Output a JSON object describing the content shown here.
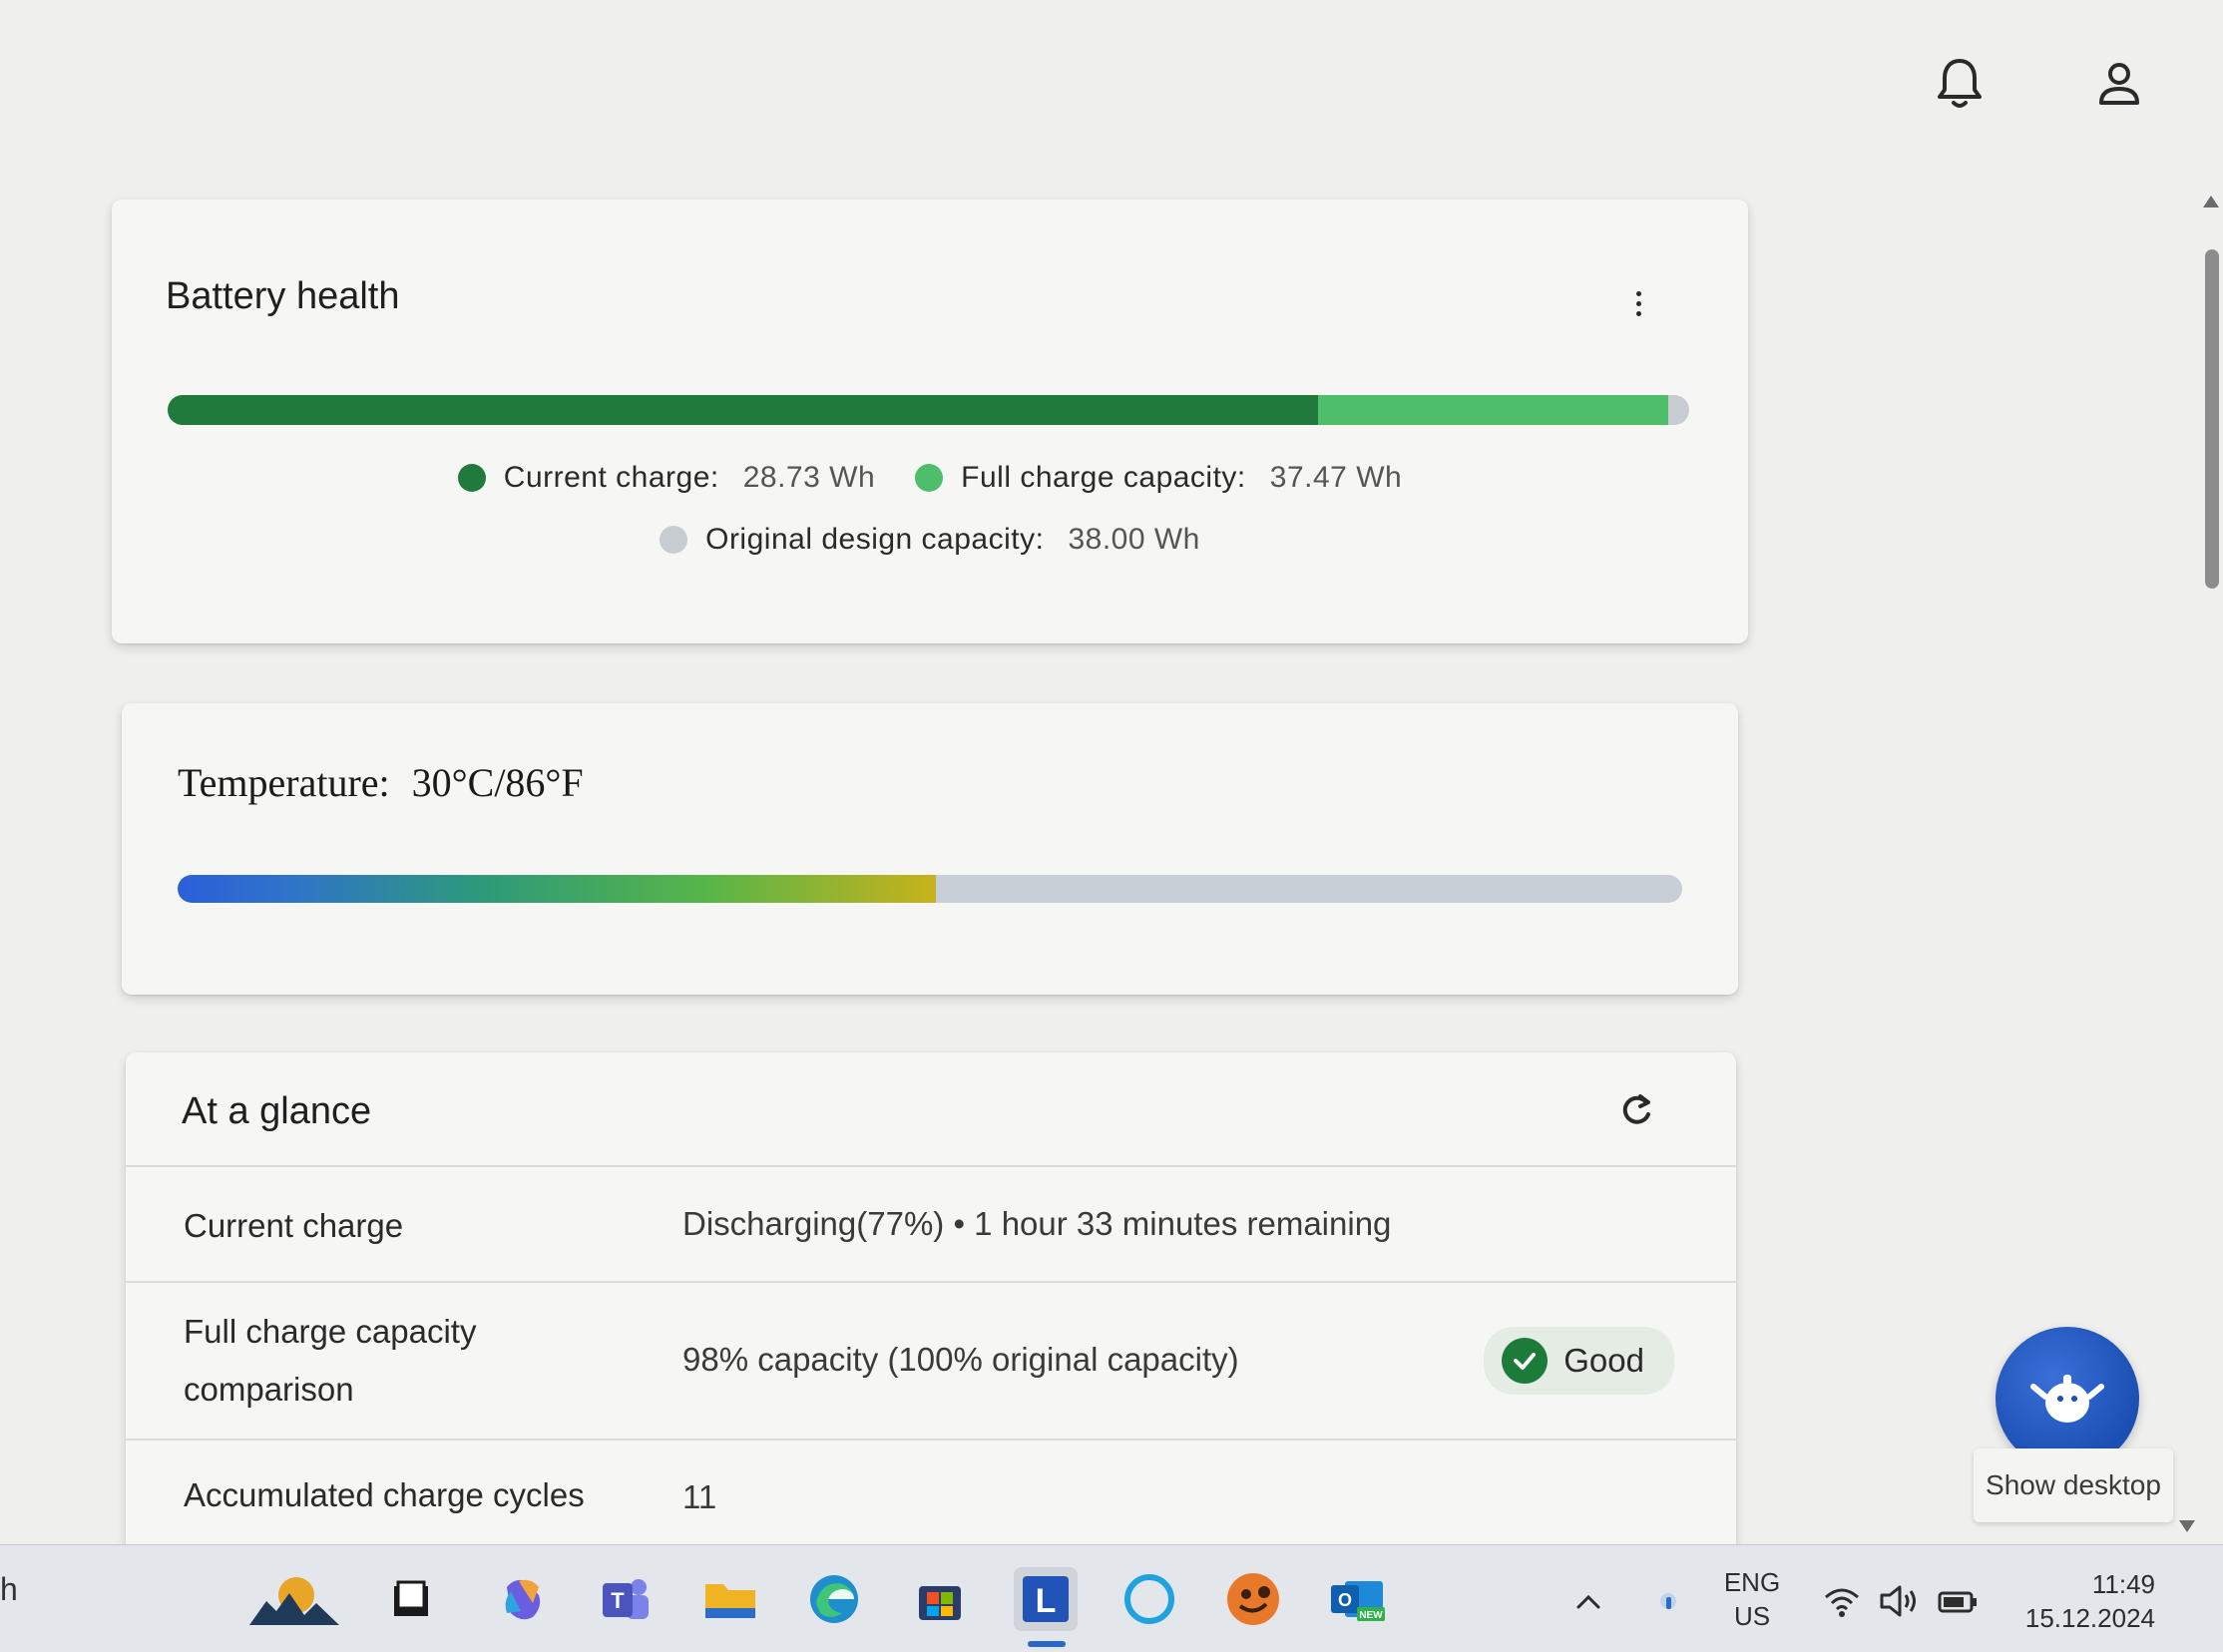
{
  "header": {
    "notifications_icon": "bell-icon",
    "account_icon": "user-icon"
  },
  "battery_health": {
    "title": "Battery health",
    "more_icon": "more-vertical-icon",
    "original_design_capacity_wh": 38.0,
    "full_charge_capacity_wh": 37.47,
    "current_charge_wh": 28.73,
    "legend": {
      "current": {
        "label": "Current charge:",
        "value": "28.73 Wh",
        "color": "#1f7a3c"
      },
      "full": {
        "label": "Full charge capacity:",
        "value": "37.47 Wh",
        "color": "#4fbe6b"
      },
      "original": {
        "label": "Original design capacity:",
        "value": "38.00 Wh",
        "color": "#c7ccd3"
      }
    }
  },
  "temperature": {
    "label": "Temperature:",
    "value": "30°C/86°F",
    "fill_fraction": 0.504
  },
  "at_a_glance": {
    "title": "At a glance",
    "refresh_icon": "refresh-icon",
    "rows": [
      {
        "label": "Current charge",
        "value": "Discharging(77%)  •  1 hour 33 minutes remaining"
      },
      {
        "label_line1": "Full charge capacity",
        "label_line2": "comparison",
        "value": "98% capacity (100% original capacity)",
        "badge": "Good"
      },
      {
        "label": "Accumulated charge cycles",
        "value": "11"
      }
    ]
  },
  "assistant": {
    "icon": "assistant-robot-icon",
    "tooltip": "Show desktop"
  },
  "taskbar": {
    "search_stub": "h",
    "apps": [
      "weather-widget-icon",
      "file-manager-icon",
      "copilot-icon",
      "teams-icon",
      "file-explorer-icon",
      "edge-icon",
      "store-icon",
      "lenovo-vantage-icon",
      "cortana-icon",
      "game-icon",
      "outlook-new-icon"
    ],
    "tray": {
      "lang_line1": "ENG",
      "lang_line2": "US",
      "time": "11:49",
      "date": "15.12.2024"
    }
  }
}
